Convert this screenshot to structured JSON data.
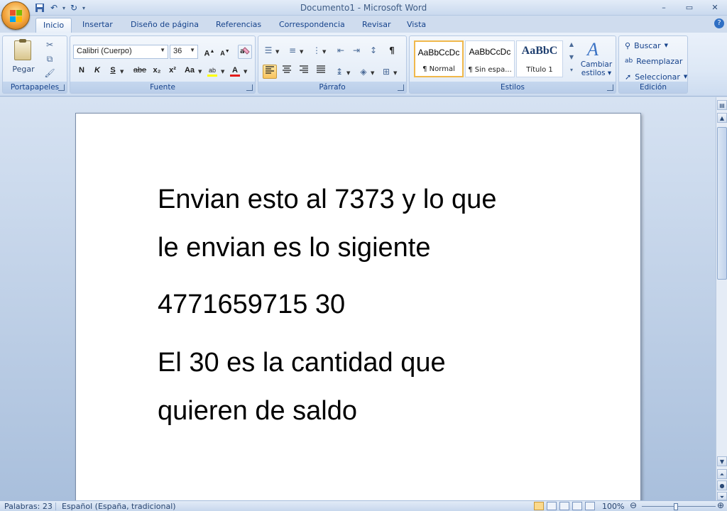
{
  "window": {
    "title": "Documento1 - Microsoft Word",
    "controls": {
      "minimize": "–",
      "maximize": "▭",
      "close": "✕"
    }
  },
  "tabs": [
    "Inicio",
    "Insertar",
    "Diseño de página",
    "Referencias",
    "Correspondencia",
    "Revisar",
    "Vista"
  ],
  "active_tab": "Inicio",
  "ribbon": {
    "clipboard": {
      "label": "Portapapeles",
      "paste_label": "Pegar"
    },
    "font": {
      "label": "Fuente",
      "font_name": "Calibri (Cuerpo)",
      "font_size": "36",
      "bold": "N",
      "italic": "K",
      "underline": "S",
      "strike": "abe",
      "subscript": "x₂",
      "superscript": "x²",
      "case": "Aa",
      "highlight": "ab",
      "font_color": "A"
    },
    "paragraph": {
      "label": "Párrafo",
      "pilcrow": "¶"
    },
    "styles": {
      "label": "Estilos",
      "items": [
        {
          "sample": "AaBbCcDc",
          "name": "¶ Normal"
        },
        {
          "sample": "AaBbCcDc",
          "name": "¶ Sin espa..."
        },
        {
          "sample": "AaBbC",
          "name": "Título 1"
        }
      ],
      "change_styles": [
        "Cambiar",
        "estilos"
      ]
    },
    "editing": {
      "label": "Edición",
      "find": "Buscar",
      "replace": "Reemplazar",
      "select": "Seleccionar"
    }
  },
  "document": {
    "lines": [
      "Envian esto al 7373 y lo que",
      "le envian es lo sigiente",
      "4771659715 30",
      "El 30 es la cantidad que",
      "quieren de saldo"
    ]
  },
  "status": {
    "words": "Palabras: 23",
    "language": "Español (España, tradicional)",
    "zoom": "100%"
  },
  "colors": {
    "accent": "#15428b",
    "highlight": "#ffff00",
    "font_color": "#e31c1c"
  }
}
